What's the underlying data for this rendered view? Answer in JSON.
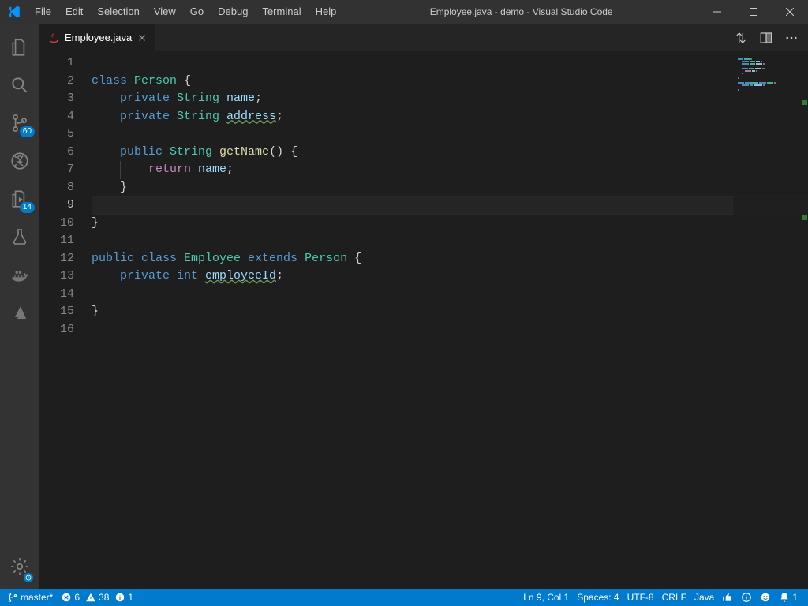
{
  "window": {
    "title": "Employee.java - demo - Visual Studio Code"
  },
  "menu": [
    "File",
    "Edit",
    "Selection",
    "View",
    "Go",
    "Debug",
    "Terminal",
    "Help"
  ],
  "activitybar": {
    "scm_badge": "60",
    "test_badge": "14"
  },
  "tab": {
    "name": "Employee.java"
  },
  "code": {
    "lines": [
      {
        "n": "1",
        "current": false,
        "segs": []
      },
      {
        "n": "2",
        "current": false,
        "segs": [
          {
            "t": "class ",
            "c": "kw"
          },
          {
            "t": "Person ",
            "c": "type"
          },
          {
            "t": "{",
            "c": "punc"
          }
        ]
      },
      {
        "n": "3",
        "current": false,
        "indent": 1,
        "segs": [
          {
            "t": "    ",
            "c": ""
          },
          {
            "t": "private ",
            "c": "kw"
          },
          {
            "t": "String ",
            "c": "type"
          },
          {
            "t": "name",
            "c": "ident"
          },
          {
            "t": ";",
            "c": "punc"
          }
        ]
      },
      {
        "n": "4",
        "current": false,
        "indent": 1,
        "segs": [
          {
            "t": "    ",
            "c": ""
          },
          {
            "t": "private ",
            "c": "kw"
          },
          {
            "t": "String ",
            "c": "type"
          },
          {
            "t": "address",
            "c": "ident squiggle"
          },
          {
            "t": ";",
            "c": "punc"
          }
        ]
      },
      {
        "n": "5",
        "current": false,
        "indent": 1,
        "segs": []
      },
      {
        "n": "6",
        "current": false,
        "indent": 1,
        "segs": [
          {
            "t": "    ",
            "c": ""
          },
          {
            "t": "public ",
            "c": "kw"
          },
          {
            "t": "String ",
            "c": "type"
          },
          {
            "t": "getName",
            "c": "method"
          },
          {
            "t": "() {",
            "c": "punc"
          }
        ]
      },
      {
        "n": "7",
        "current": false,
        "indent": 2,
        "segs": [
          {
            "t": "        ",
            "c": ""
          },
          {
            "t": "return ",
            "c": "ret"
          },
          {
            "t": "name",
            "c": "ident"
          },
          {
            "t": ";",
            "c": "punc"
          }
        ]
      },
      {
        "n": "8",
        "current": false,
        "indent": 1,
        "segs": [
          {
            "t": "    ",
            "c": ""
          },
          {
            "t": "}",
            "c": "punc"
          }
        ]
      },
      {
        "n": "9",
        "current": true,
        "indent": 1,
        "segs": []
      },
      {
        "n": "10",
        "current": false,
        "segs": [
          {
            "t": "}",
            "c": "punc"
          }
        ]
      },
      {
        "n": "11",
        "current": false,
        "segs": []
      },
      {
        "n": "12",
        "current": false,
        "segs": [
          {
            "t": "public ",
            "c": "kw"
          },
          {
            "t": "class ",
            "c": "kw"
          },
          {
            "t": "Employee ",
            "c": "type"
          },
          {
            "t": "extends ",
            "c": "kw"
          },
          {
            "t": "Person ",
            "c": "type"
          },
          {
            "t": "{",
            "c": "punc"
          }
        ]
      },
      {
        "n": "13",
        "current": false,
        "indent": 1,
        "segs": [
          {
            "t": "    ",
            "c": ""
          },
          {
            "t": "private ",
            "c": "kw"
          },
          {
            "t": "int ",
            "c": "kw"
          },
          {
            "t": "employeeId",
            "c": "ident squiggle"
          },
          {
            "t": ";",
            "c": "punc"
          }
        ]
      },
      {
        "n": "14",
        "current": false,
        "indent": 1,
        "segs": []
      },
      {
        "n": "15",
        "current": false,
        "segs": [
          {
            "t": "}",
            "c": "punc"
          }
        ]
      },
      {
        "n": "16",
        "current": false,
        "segs": []
      }
    ]
  },
  "statusbar": {
    "branch": "master*",
    "errors": "6",
    "warnings": "38",
    "infos": "1",
    "cursor": "Ln 9, Col 1",
    "spaces": "Spaces: 4",
    "encoding": "UTF-8",
    "eol": "CRLF",
    "lang": "Java",
    "notif": "1"
  }
}
